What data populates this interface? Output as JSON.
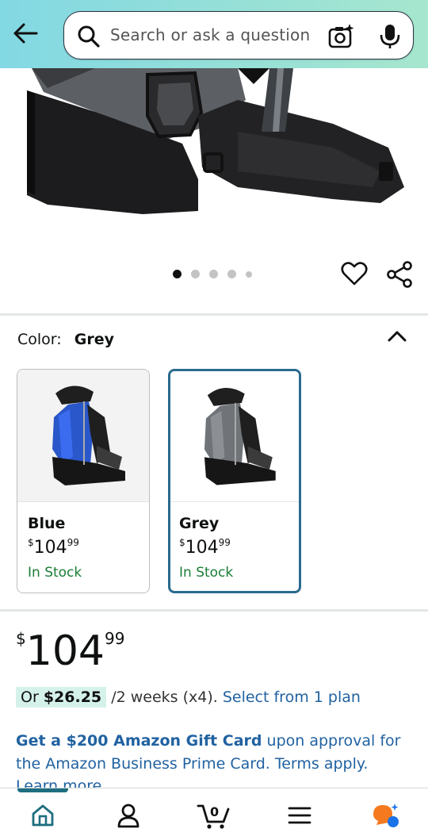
{
  "header": {
    "back_icon": "arrow-left-icon",
    "search_placeholder": "Search or ask a question",
    "search_icon": "search-icon",
    "camera_icon": "camera-sparkle-icon",
    "mic_icon": "microphone-icon",
    "gradient_start": "#82d8e3",
    "gradient_end": "#a6e6ce"
  },
  "gallery": {
    "image_count": 5,
    "active_index": 0
  },
  "color_selector": {
    "label": "Color:",
    "selected_value": "Grey",
    "options": [
      {
        "name": "Blue",
        "price_symbol": "$",
        "price_whole": "104",
        "price_fraction": "99",
        "stock": "In Stock",
        "selected": false
      },
      {
        "name": "Grey",
        "price_symbol": "$",
        "price_whole": "104",
        "price_fraction": "99",
        "stock": "In Stock",
        "selected": true
      }
    ]
  },
  "price": {
    "symbol": "$",
    "whole": "104",
    "fraction": "99"
  },
  "installment": {
    "prefix": "Or",
    "amount": "$26.25",
    "terms": "/2 weeks (x4).",
    "link": "Select from 1 plan"
  },
  "promo": {
    "bold": "Get a $200 Amazon Gift Card",
    "rest": "upon approval for the Amazon Business Prime Card. Terms apply.",
    "learn_more": "Learn more"
  },
  "bottom_nav": {
    "items": [
      "home-icon",
      "account-icon",
      "cart-icon",
      "menu-icon",
      "rufus-icon"
    ],
    "cart_count": "0",
    "active": "home",
    "accent": "#1f6e80"
  },
  "colors": {
    "link": "#2162a1",
    "in_stock": "#1a7d35",
    "selected_border": "#2b6a8e"
  }
}
